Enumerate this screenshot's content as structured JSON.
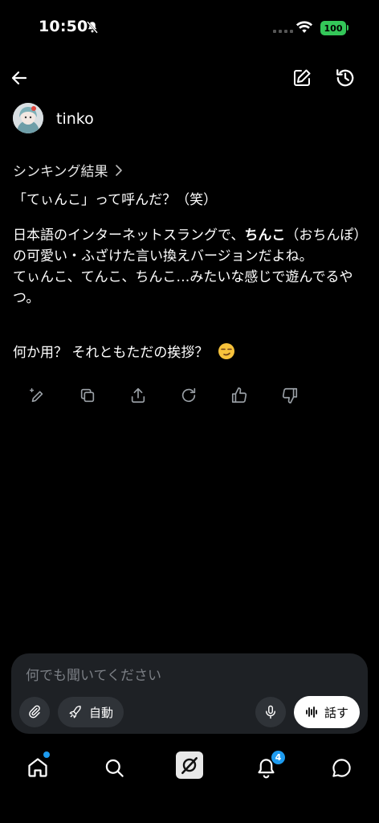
{
  "status": {
    "time": "10:50",
    "battery": "100"
  },
  "header": {
    "model_name": "tinko"
  },
  "thinking": {
    "label": "シンキング結果"
  },
  "message": {
    "line1": "「てぃんこ」って呼んだ？（笑）",
    "p2_before": "日本語のインターネットスラングで、",
    "p2_bold": "ちんこ",
    "p2_after": "（おちんぽ）の可愛い・ふざけた言い換えバージョンだよね。",
    "p2_line2": "てぃんこ、てんこ、ちんこ…みたいな感じで遊んでるやつ。",
    "p3_text": "何か用？ それともただの挨拶？",
    "p3_emoji": "smirking-face"
  },
  "actions": [
    "edit-sparkle-icon",
    "copy-icon",
    "share-icon",
    "regenerate-icon",
    "thumbs-up-icon",
    "thumbs-down-icon"
  ],
  "composer": {
    "placeholder": "何でも聞いてください",
    "auto_label": "自動",
    "talk_label": "話す"
  },
  "tabbar": {
    "notifications_count": "4"
  },
  "colors": {
    "accent": "#1d9bf0",
    "battery": "#34c759",
    "composer_bg": "#1e2125"
  }
}
